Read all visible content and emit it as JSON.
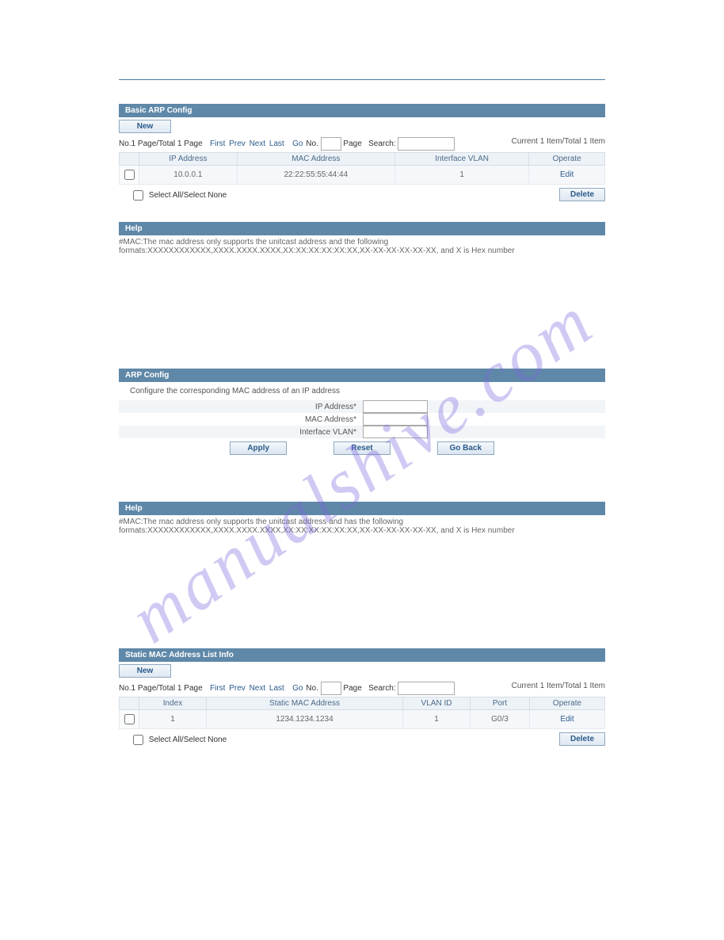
{
  "watermark": "manualshive.com",
  "panel1": {
    "title": "Basic ARP Config",
    "new_label": "New",
    "page_info": "No.1 Page/Total 1 Page",
    "first": "First",
    "prev": "Prev",
    "next": "Next",
    "last": "Last",
    "go": "Go",
    "no": "No.",
    "page": "Page",
    "search": "Search:",
    "items_info": "Current 1 Item/Total 1 Item",
    "headers": {
      "ip": "IP Address",
      "mac": "MAC Address",
      "vlan": "Interface VLAN",
      "operate": "Operate"
    },
    "row": {
      "ip": "10.0.0.1",
      "mac": "22:22:55:55:44:44",
      "vlan": "1",
      "edit": "Edit"
    },
    "select_all": "Select All/Select None",
    "delete": "Delete",
    "help_title": "Help",
    "help_text": "#MAC:The mac address only supports the unitcast address and the following formats:XXXXXXXXXXXX,XXXX.XXXX.XXXX,XX:XX:XX:XX:XX:XX,XX-XX-XX-XX-XX-XX, and X is Hex number"
  },
  "panel2": {
    "title": "ARP Config",
    "instruction": "Configure the corresponding MAC address of an IP address",
    "ip_label": "IP Address*",
    "mac_label": "MAC Address*",
    "vlan_label": "Interface VLAN*",
    "apply": "Apply",
    "reset": "Reset",
    "goback": "Go Back",
    "help_title": "Help",
    "help_text": "#MAC:The mac address only supports the unitcast address and has the following formats:XXXXXXXXXXXX,XXXX.XXXX.XXXX,XX:XX:XX:XX:XX:XX,XX-XX-XX-XX-XX-XX, and X is Hex number"
  },
  "panel3": {
    "title": "Static MAC Address List Info",
    "new_label": "New",
    "page_info": "No.1 Page/Total 1 Page",
    "first": "First",
    "prev": "Prev",
    "next": "Next",
    "last": "Last",
    "go": "Go",
    "no": "No.",
    "page": "Page",
    "search": "Search:",
    "items_info": "Current 1 Item/Total 1 Item",
    "headers": {
      "index": "Index",
      "mac": "Static MAC Address",
      "vlan": "VLAN ID",
      "port": "Port",
      "operate": "Operate"
    },
    "row": {
      "index": "1",
      "mac": "1234.1234.1234",
      "vlan": "1",
      "port": "G0/3",
      "edit": "Edit"
    },
    "select_all": "Select All/Select None",
    "delete": "Delete"
  }
}
